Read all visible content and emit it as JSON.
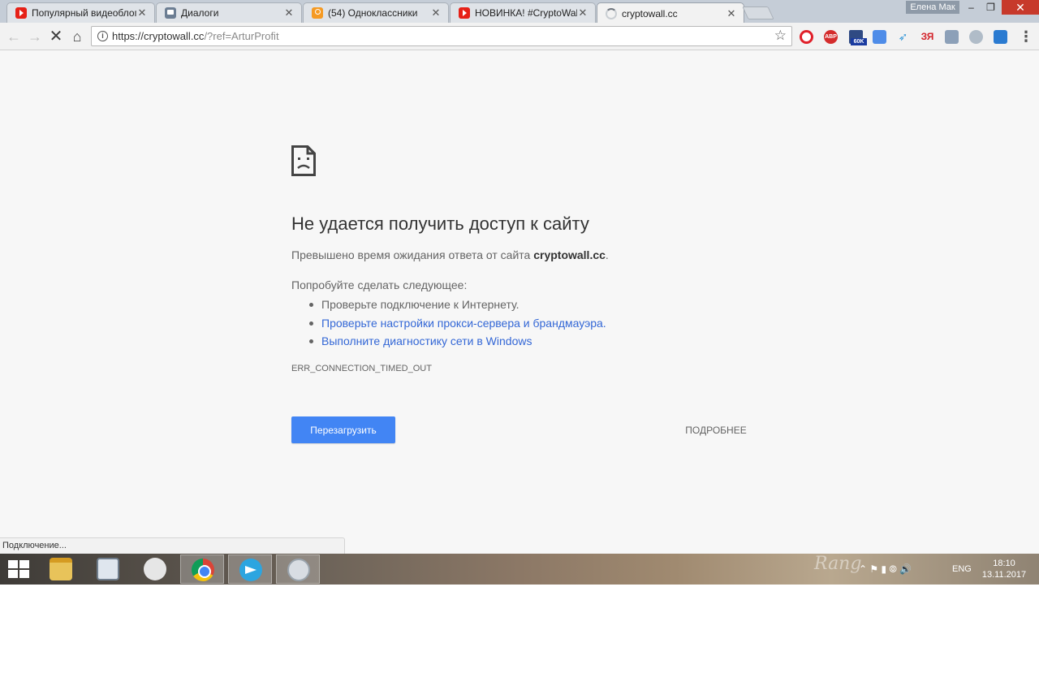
{
  "window": {
    "profile_name": "Елена Мак",
    "minimize_glyph": "–",
    "restore_glyph": "❐",
    "close_glyph": "✕"
  },
  "tabs": [
    {
      "title": "Популярный видеоблог",
      "favicon": "youtube-icon",
      "close": "✕"
    },
    {
      "title": "Диалоги",
      "favicon": "vk-icon",
      "close": "✕"
    },
    {
      "title": "(54) Одноклассники",
      "favicon": "odnoklassniki-icon",
      "close": "✕"
    },
    {
      "title": "НОВИНКА! #CryptoWall",
      "favicon": "youtube-icon",
      "close": "✕"
    },
    {
      "title": "cryptowall.cc",
      "favicon": "loading-spinner-icon",
      "close": "✕",
      "active": true
    }
  ],
  "toolbar": {
    "back_glyph": "←",
    "forward_glyph": "→",
    "stop_glyph": "✕",
    "home_glyph": "⌂",
    "info_glyph": "i",
    "url_host": "https://cryptowall.cc",
    "url_path": "/?ref=ArturProfit",
    "star_glyph": "☆",
    "menu_glyph": "⋮",
    "ext_abp_label": "ABP",
    "ext_badge": "60K",
    "ext_bird_glyph": "➶",
    "ext_ya_label": "ЗЯ"
  },
  "error": {
    "heading": "Не удается получить доступ к сайту",
    "summary_prefix": "Превышено время ожидания ответа от сайта ",
    "summary_host": "cryptowall.cc",
    "summary_suffix": ".",
    "suggest_heading": "Попробуйте сделать следующее:",
    "suggestions": [
      "Проверьте подключение к Интернету.",
      "Проверьте настройки прокси-сервера и брандмауэра.",
      "Выполните диагностику сети в Windows"
    ],
    "code": "ERR_CONNECTION_TIMED_OUT",
    "reload_label": "Перезагрузить",
    "details_label": "ПОДРОБНЕЕ"
  },
  "status_bar": "Подключение...",
  "taskbar": {
    "watermark": "Rang",
    "language": "ENG",
    "time": "18:10",
    "date": "13.11.2017",
    "tray_glyphs": "⌃ ⚑ ▮ ⦾ 🔊"
  },
  "colors": {
    "accent": "#4285f4",
    "link": "#3367d6",
    "close_red": "#c7392b"
  }
}
